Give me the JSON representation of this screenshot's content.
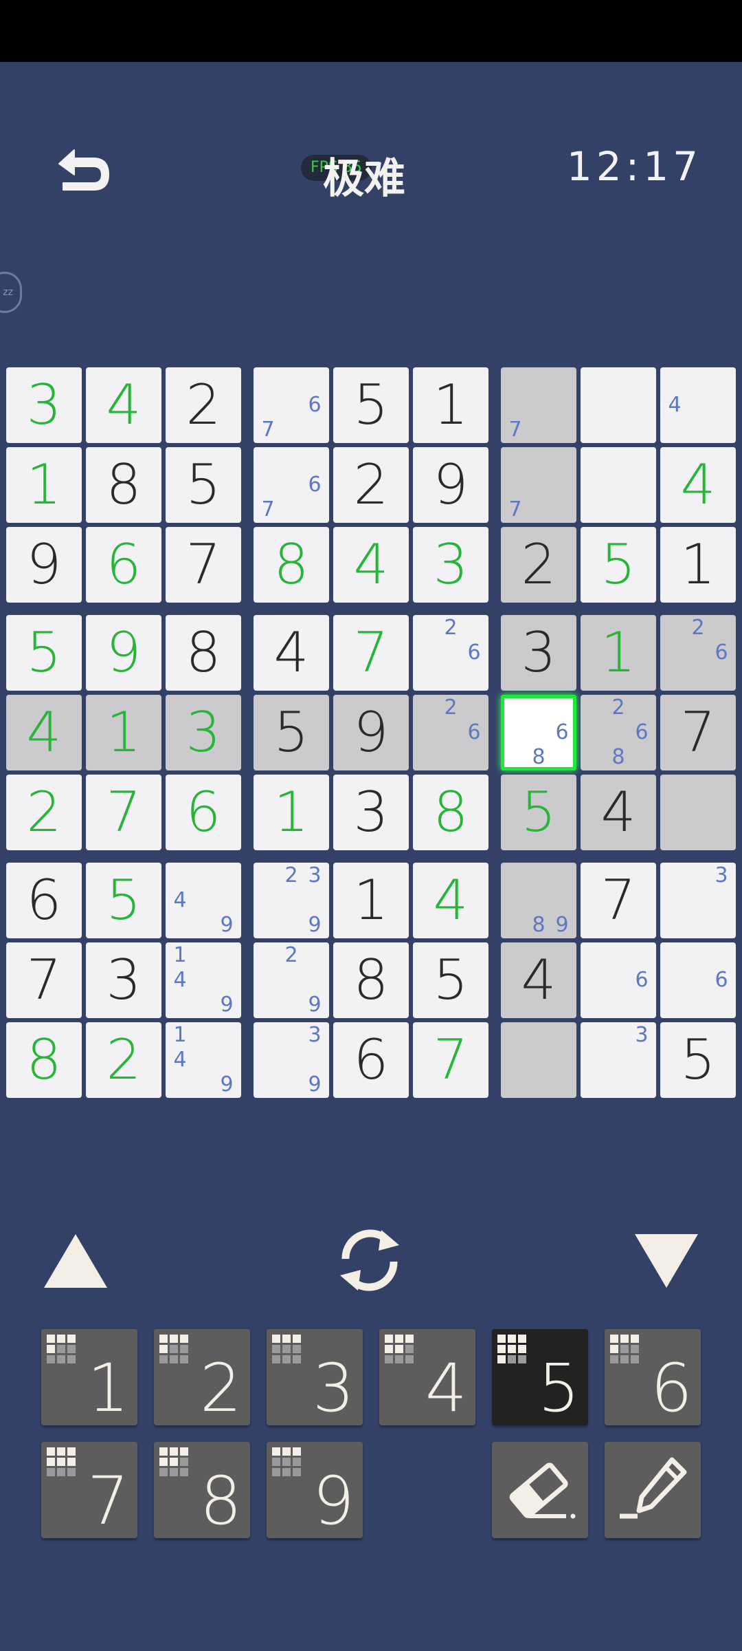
{
  "header": {
    "title": "极难",
    "fps_badge": "FPS 35",
    "timer": "12:17",
    "side_badge": "zz"
  },
  "board": {
    "cells": [
      [
        {
          "v": "3",
          "c": "g"
        },
        {
          "v": "4",
          "c": "g"
        },
        {
          "v": "2",
          "c": "k"
        },
        {
          "n": [
            6,
            7
          ]
        },
        {
          "v": "5",
          "c": "k"
        },
        {
          "v": "1",
          "c": "k"
        },
        {
          "n": [
            7
          ],
          "gray": true
        },
        {},
        {
          "n": [
            4
          ]
        }
      ],
      [
        {
          "v": "1",
          "c": "g"
        },
        {
          "v": "8",
          "c": "k"
        },
        {
          "v": "5",
          "c": "k"
        },
        {
          "n": [
            6,
            7
          ]
        },
        {
          "v": "2",
          "c": "k"
        },
        {
          "v": "9",
          "c": "k"
        },
        {
          "n": [
            7
          ],
          "gray": true
        },
        {},
        {
          "v": "4",
          "c": "g"
        }
      ],
      [
        {
          "v": "9",
          "c": "k"
        },
        {
          "v": "6",
          "c": "g"
        },
        {
          "v": "7",
          "c": "k"
        },
        {
          "v": "8",
          "c": "g"
        },
        {
          "v": "4",
          "c": "g"
        },
        {
          "v": "3",
          "c": "g"
        },
        {
          "v": "2",
          "c": "k",
          "gray": true
        },
        {
          "v": "5",
          "c": "g"
        },
        {
          "v": "1",
          "c": "k"
        }
      ],
      [
        {
          "v": "5",
          "c": "g"
        },
        {
          "v": "9",
          "c": "g"
        },
        {
          "v": "8",
          "c": "k"
        },
        {
          "v": "4",
          "c": "k"
        },
        {
          "v": "7",
          "c": "g"
        },
        {
          "n": [
            2,
            6
          ]
        },
        {
          "v": "3",
          "c": "k",
          "gray": true
        },
        {
          "v": "1",
          "c": "g",
          "gray": true
        },
        {
          "n": [
            2,
            6
          ],
          "gray": true
        }
      ],
      [
        {
          "v": "4",
          "c": "g",
          "gray": true
        },
        {
          "v": "1",
          "c": "g",
          "gray": true
        },
        {
          "v": "3",
          "c": "g",
          "gray": true
        },
        {
          "v": "5",
          "c": "k",
          "gray": true
        },
        {
          "v": "9",
          "c": "k",
          "gray": true
        },
        {
          "n": [
            2,
            6
          ],
          "gray": true
        },
        {
          "n": [
            6,
            8
          ],
          "sel": true
        },
        {
          "n": [
            2,
            6,
            8
          ],
          "gray": true
        },
        {
          "v": "7",
          "c": "k",
          "gray": true
        }
      ],
      [
        {
          "v": "2",
          "c": "g"
        },
        {
          "v": "7",
          "c": "g"
        },
        {
          "v": "6",
          "c": "g"
        },
        {
          "v": "1",
          "c": "g"
        },
        {
          "v": "3",
          "c": "k"
        },
        {
          "v": "8",
          "c": "g"
        },
        {
          "v": "5",
          "c": "g",
          "gray": true
        },
        {
          "v": "4",
          "c": "k",
          "gray": true
        },
        {
          "gray": true
        }
      ],
      [
        {
          "v": "6",
          "c": "k"
        },
        {
          "v": "5",
          "c": "g"
        },
        {
          "n": [
            4,
            9
          ]
        },
        {
          "n": [
            2,
            3,
            9
          ]
        },
        {
          "v": "1",
          "c": "k"
        },
        {
          "v": "4",
          "c": "g"
        },
        {
          "n": [
            8,
            9
          ],
          "gray": true
        },
        {
          "v": "7",
          "c": "k"
        },
        {
          "n": [
            3
          ]
        }
      ],
      [
        {
          "v": "7",
          "c": "k"
        },
        {
          "v": "3",
          "c": "k"
        },
        {
          "n": [
            1,
            4,
            9
          ]
        },
        {
          "n": [
            2,
            9
          ]
        },
        {
          "v": "8",
          "c": "k"
        },
        {
          "v": "5",
          "c": "k"
        },
        {
          "v": "4",
          "c": "k",
          "gray": true
        },
        {
          "n": [
            6
          ]
        },
        {
          "n": [
            6
          ]
        }
      ],
      [
        {
          "v": "8",
          "c": "g"
        },
        {
          "v": "2",
          "c": "g"
        },
        {
          "n": [
            1,
            4,
            9
          ]
        },
        {
          "n": [
            3,
            9
          ]
        },
        {
          "v": "6",
          "c": "k"
        },
        {
          "v": "7",
          "c": "g"
        },
        {
          "gray": true
        },
        {
          "n": [
            3
          ]
        },
        {
          "v": "5",
          "c": "k"
        }
      ]
    ]
  },
  "controls": {
    "up_icon": "triangle-up-icon",
    "redo_icon": "refresh-icon",
    "down_icon": "triangle-down-icon"
  },
  "numpad": {
    "keys": [
      {
        "label": "1",
        "done": 4,
        "active": false
      },
      {
        "label": "2",
        "done": 4,
        "active": false
      },
      {
        "label": "3",
        "done": 3,
        "active": false
      },
      {
        "label": "4",
        "done": 5,
        "active": false
      },
      {
        "label": "5",
        "done": 7,
        "active": true
      },
      {
        "label": "6",
        "done": 4,
        "active": false
      },
      {
        "label": "7",
        "done": 6,
        "active": false
      },
      {
        "label": "8",
        "done": 5,
        "active": false
      },
      {
        "label": "9",
        "done": 3,
        "active": false
      }
    ],
    "eraser_icon": "eraser-icon",
    "pencil_icon": "pencil-icon"
  },
  "colors": {
    "background": "#334167",
    "given": "#2a2a2a",
    "entered": "#27b537",
    "note": "#5d78c2",
    "highlight": "#cbcbcd",
    "selected_glow": "#1ee83a"
  }
}
